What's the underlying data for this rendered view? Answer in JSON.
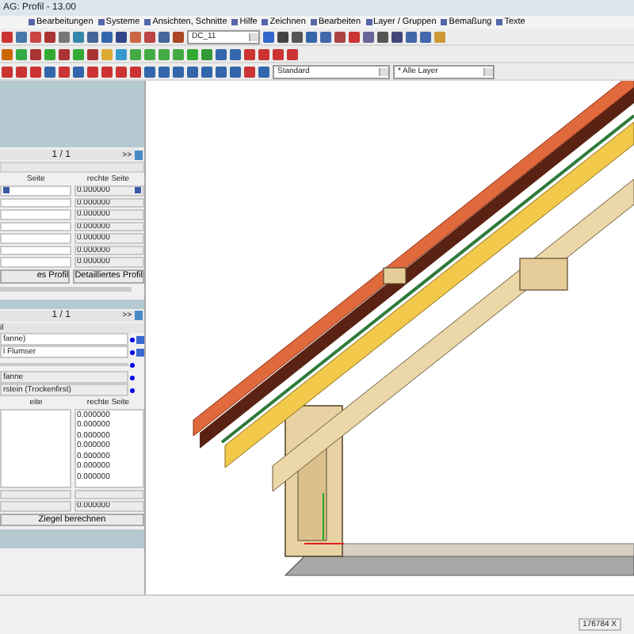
{
  "window": {
    "title": "AG: Profil - 13.00"
  },
  "menu": [
    "Bearbeitungen",
    "Systeme",
    "Ansichten, Schnitte",
    "Hilfe",
    "Zeichnen",
    "Bearbeiten",
    "Layer / Gruppen",
    "Bemaßung",
    "Texte"
  ],
  "toolbar": {
    "drawing_dropdown": "DC_11",
    "style_dropdown": "Standard",
    "layer_dropdown": "* Alle Layer"
  },
  "profile_panel": {
    "pager": "1 / 1",
    "next": ">>",
    "columns": [
      "Seite",
      "rechte Seite"
    ],
    "right_values": [
      "0.000000",
      "0.000000",
      "0.000000",
      "0.000000",
      "0.000000",
      "0.000000",
      "0.000000"
    ],
    "buttons": [
      "es Profil",
      "Detailliertes Profil"
    ]
  },
  "tile_panel": {
    "pager": "1 / 1",
    "next": ">>",
    "label": "il",
    "fields": [
      {
        "value": "fanne)",
        "edit_button": true
      },
      {
        "value": "l Flumser",
        "edit_button": true
      },
      {
        "edit_button": false
      },
      {
        "value": "fanne",
        "edit_button": false
      },
      {
        "value": "rstein (Trockenfirst)",
        "edit_button": false
      }
    ],
    "columns": [
      "eite",
      "rechte Seite"
    ],
    "values": [
      "0.000000",
      "0.000000",
      "0.000000",
      "0.000000",
      "0.000000",
      "0.000000",
      "0.000000"
    ],
    "result": "0.000000",
    "button": "Ziegel berechnen"
  },
  "status_bar": {
    "coordinate": "176784 X"
  }
}
